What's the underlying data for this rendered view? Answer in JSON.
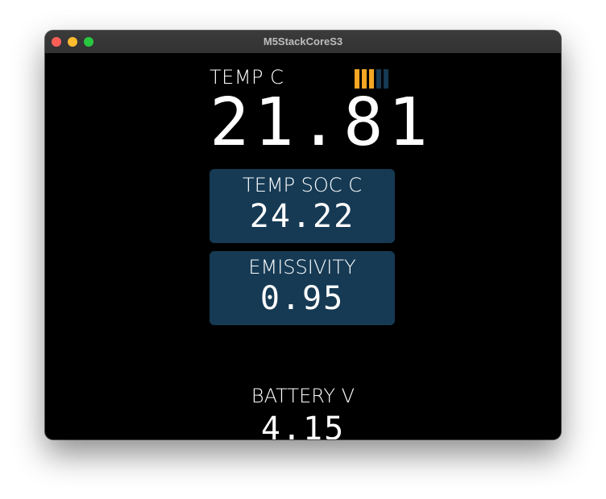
{
  "window": {
    "title": "M5StackCoreS3"
  },
  "screen": {
    "temp": {
      "label": "TEMP C",
      "value": "21.81"
    },
    "battery_indicator": {
      "levels_filled": 3,
      "levels_total": 5,
      "filled_color": "#f5a623",
      "empty_color": "#163a54"
    },
    "soc": {
      "label": "TEMP SOC C",
      "value": "24.22"
    },
    "emissivity": {
      "label": "EMISSIVITY",
      "value": "0.95"
    },
    "battery": {
      "label": "BATTERY V",
      "value": "4.15"
    },
    "colors": {
      "panel_bg": "#163a54",
      "screen_bg": "#000000",
      "text": "#ffffff"
    }
  }
}
